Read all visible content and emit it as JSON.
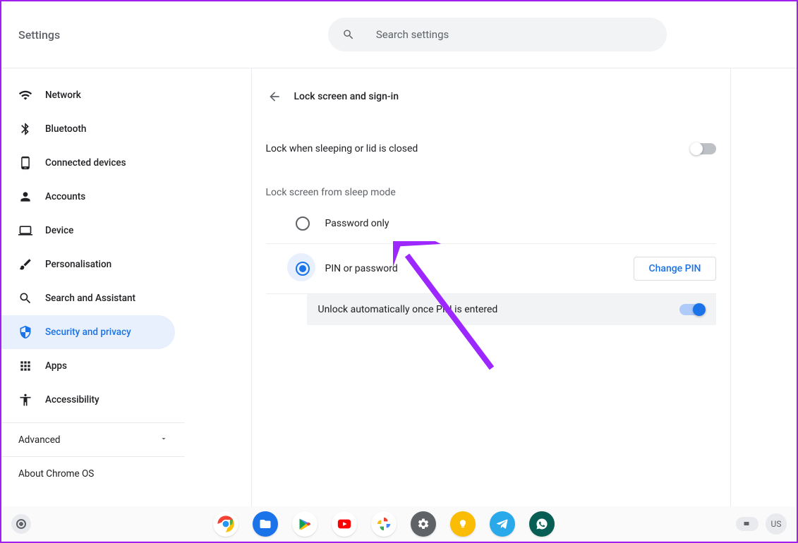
{
  "app_title": "Settings",
  "search": {
    "placeholder": "Search settings"
  },
  "sidebar": {
    "items": [
      {
        "label": "Network"
      },
      {
        "label": "Bluetooth"
      },
      {
        "label": "Connected devices"
      },
      {
        "label": "Accounts"
      },
      {
        "label": "Device"
      },
      {
        "label": "Personalisation"
      },
      {
        "label": "Search and Assistant"
      },
      {
        "label": "Security and privacy"
      },
      {
        "label": "Apps"
      },
      {
        "label": "Accessibility"
      }
    ],
    "advanced": "Advanced",
    "about": "About Chrome OS"
  },
  "page": {
    "title": "Lock screen and sign-in",
    "lock_sleep": "Lock when sleeping or lid is closed",
    "lock_from_sleep_head": "Lock screen from sleep mode",
    "radio_password": "Password only",
    "radio_pin": "PIN or password",
    "change_pin": "Change PIN",
    "auto_unlock": "Unlock automatically once PIN is entered"
  },
  "shelf": {
    "keyboard_indicator": "US"
  }
}
